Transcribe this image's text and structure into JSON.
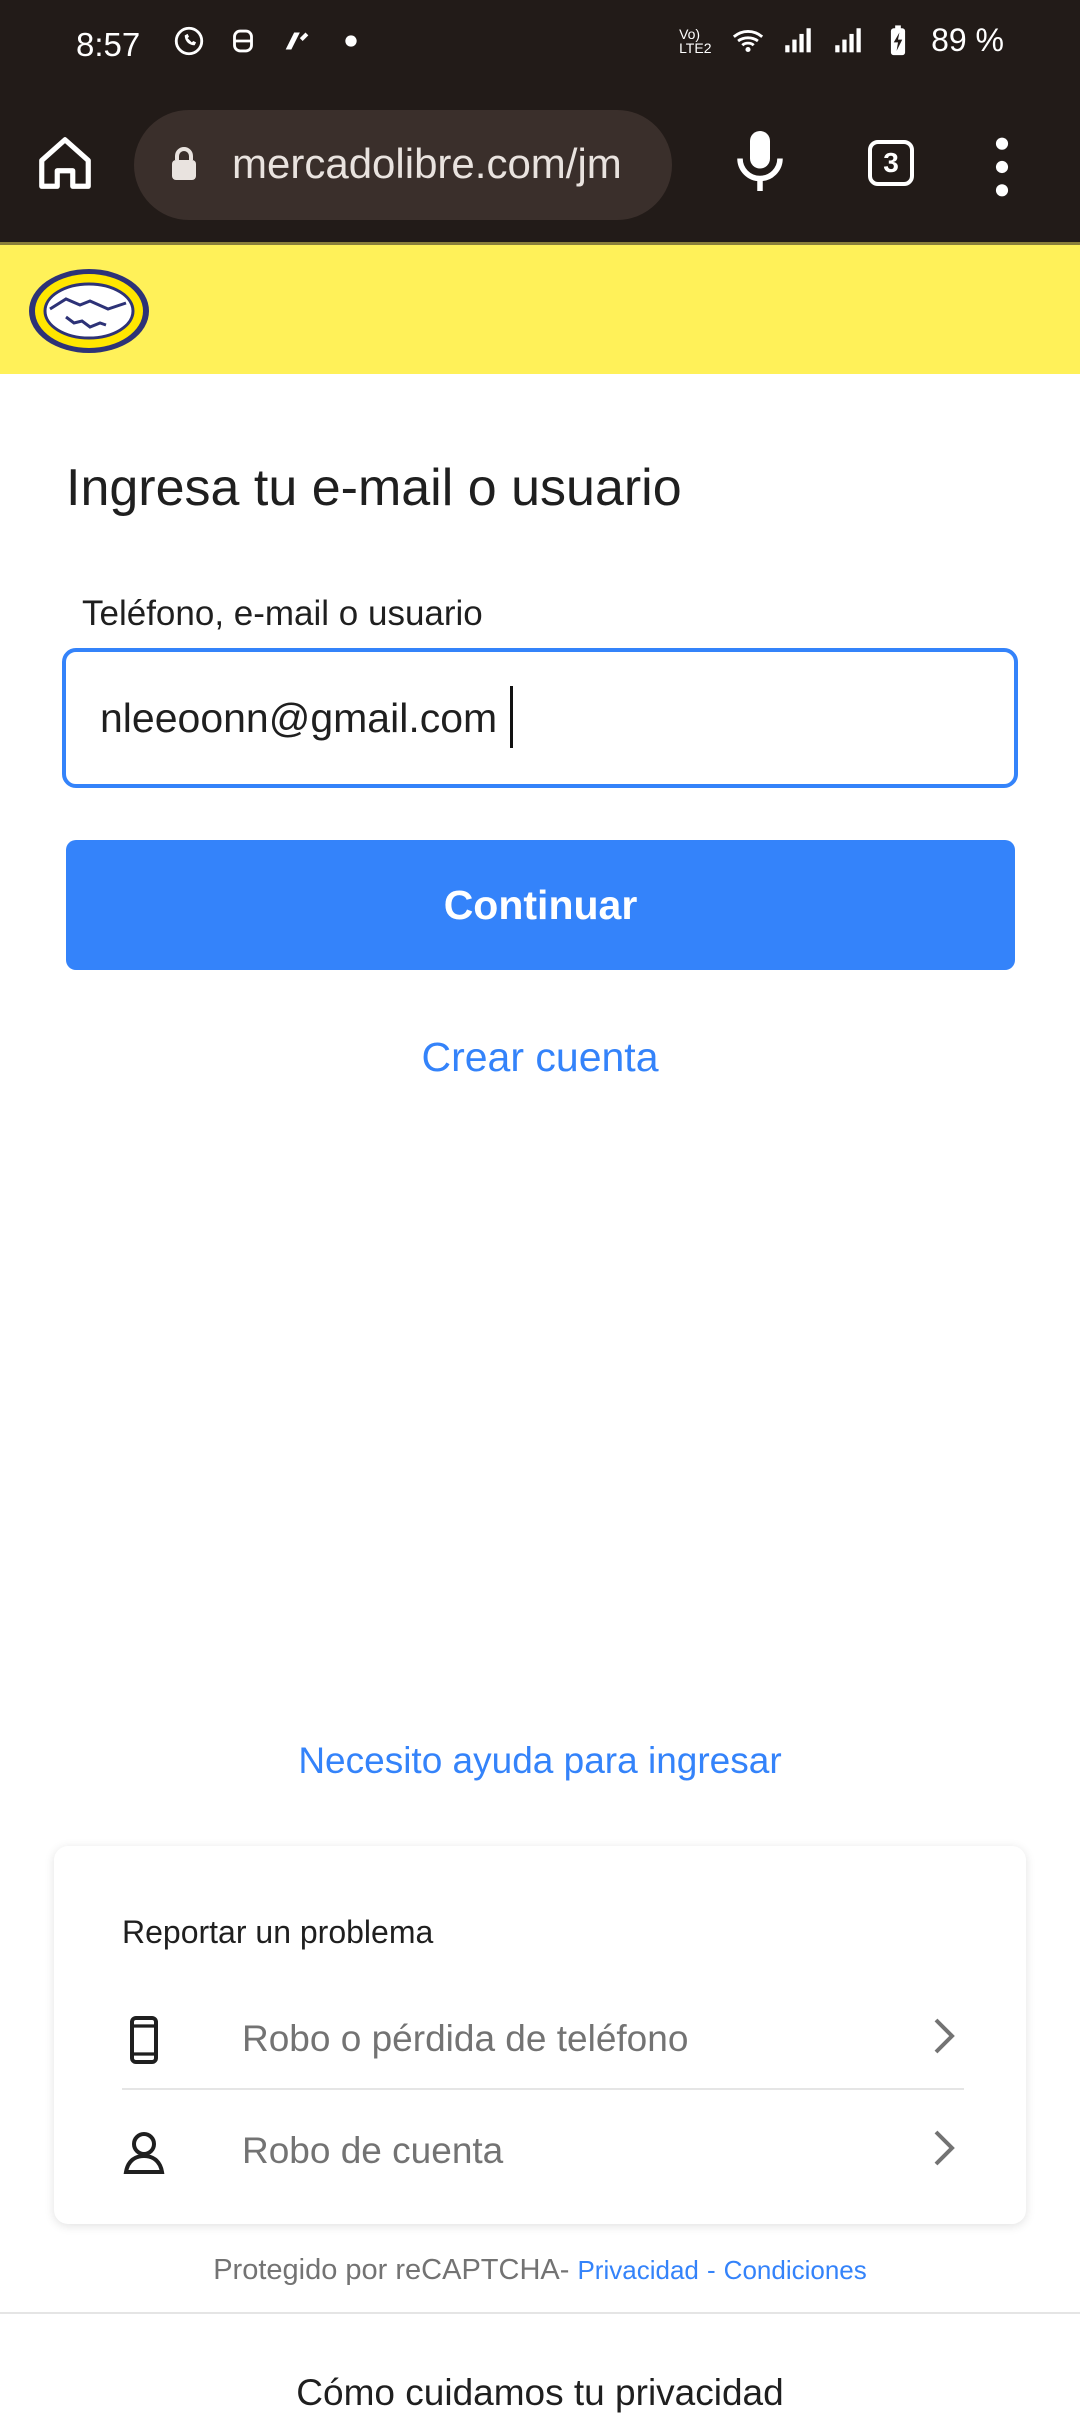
{
  "status_bar": {
    "time": "8:57",
    "icons_left": [
      "whatsapp-icon",
      "mask-icon",
      "news-icon",
      "dot-icon"
    ],
    "icons_right": [
      "volte-icon",
      "wifi-icon",
      "signal-icon",
      "signal-icon",
      "battery-charging-icon"
    ],
    "volte_text": "Vo) LTE2",
    "battery": "89 %"
  },
  "browser": {
    "url": "mercadolibre.com/jm",
    "tab_count": "3"
  },
  "page": {
    "title": "Ingresa tu e-mail o usuario",
    "field_label": "Teléfono, e-mail o usuario",
    "email_value": "nleeoonn@gmail.com",
    "continue_label": "Continuar",
    "create_account": "Crear cuenta",
    "help_link": "Necesito ayuda para ingresar"
  },
  "report": {
    "title": "Reportar un problema",
    "items": [
      {
        "label": "Robo o pérdida de teléfono",
        "icon": "phone-icon"
      },
      {
        "label": "Robo de cuenta",
        "icon": "user-icon"
      }
    ]
  },
  "footer": {
    "recaptcha_prefix": "Protegido por reCAPTCHA-",
    "privacy": "Privacidad",
    "separator": "-",
    "conditions": "Condiciones",
    "privacy_heading": "Cómo cuidamos tu privacidad"
  },
  "colors": {
    "brand_yellow": "#fff159",
    "brand_blue": "#3483fa",
    "toolbar_dark": "#221b18"
  }
}
